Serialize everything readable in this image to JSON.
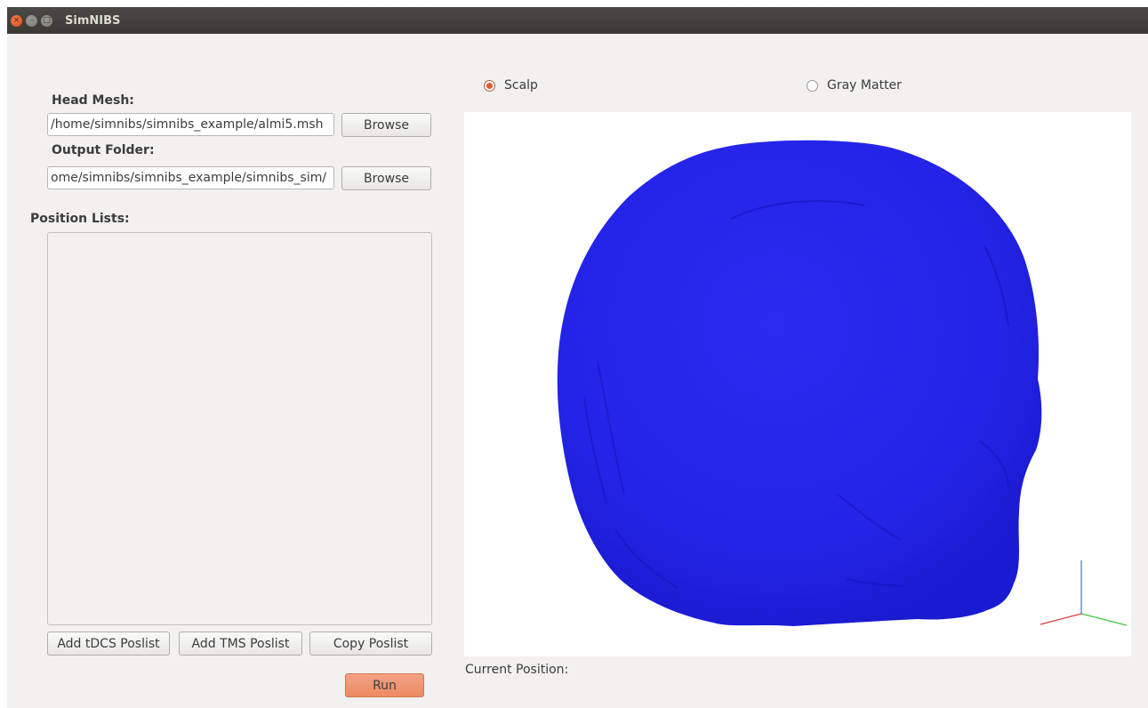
{
  "window": {
    "title": "SimNIBS",
    "close_glyph": "×",
    "min_glyph": "–",
    "max_glyph": "□"
  },
  "head_mesh": {
    "label": "Head Mesh:",
    "value": "/home/simnibs/simnibs_example/almi5.msh",
    "browse_label": "Browse"
  },
  "output_folder": {
    "label": "Output Folder:",
    "value": "ome/simnibs/simnibs_example/simnibs_sim/",
    "browse_label": "Browse"
  },
  "position_lists": {
    "label": "Position Lists:",
    "items": []
  },
  "actions": {
    "add_tdcs": "Add tDCS Poslist",
    "add_tms": "Add TMS Poslist",
    "copy": "Copy Poslist",
    "run": "Run"
  },
  "view": {
    "surface_options": [
      "Scalp",
      "Gray Matter"
    ],
    "selected_surface": "Scalp",
    "current_position_label": "Current Position:",
    "head_color": "#2424e8",
    "axis_colors": {
      "x": "#e03c3c",
      "y": "#3cc83c",
      "z": "#4a6ee0"
    }
  }
}
